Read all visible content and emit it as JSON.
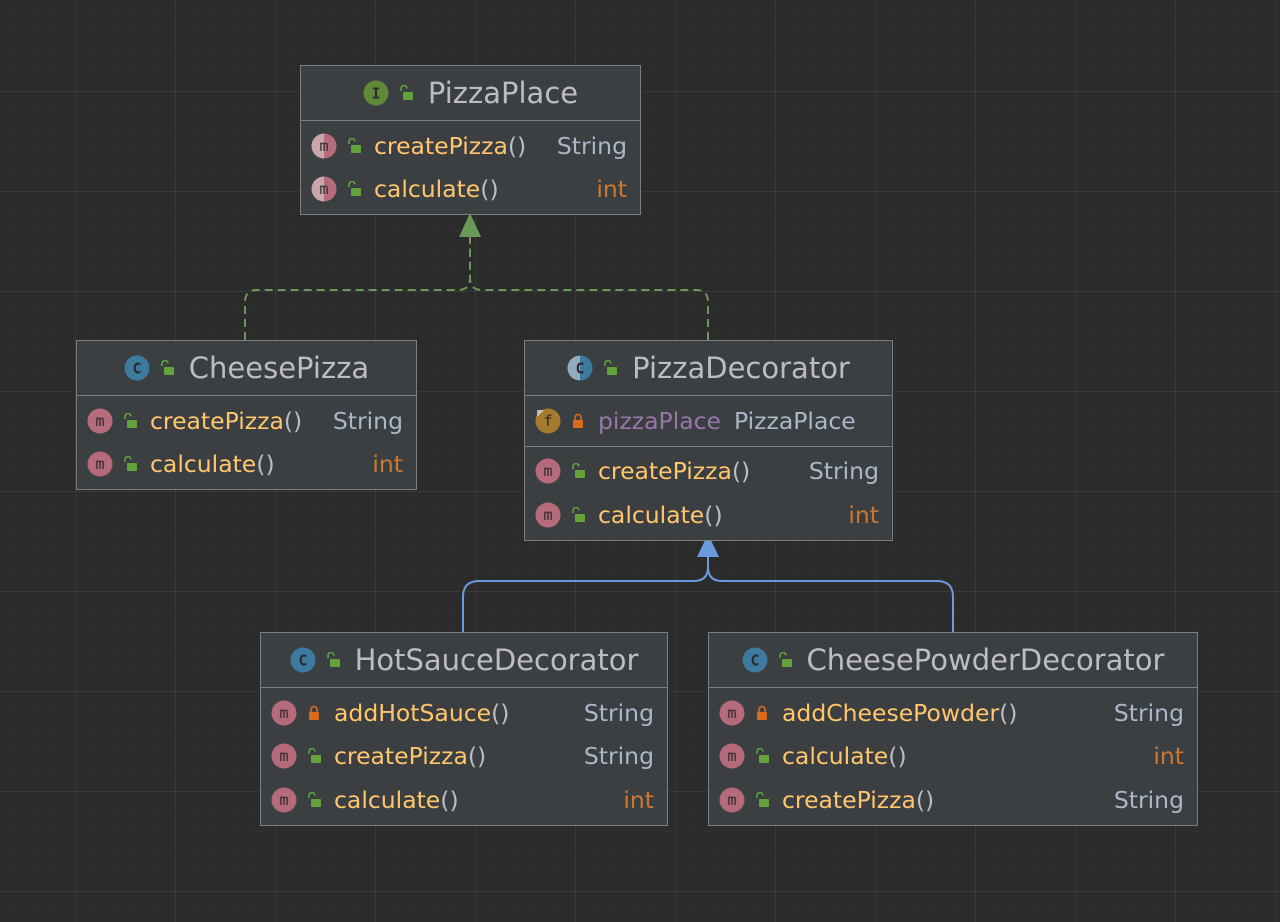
{
  "colors": {
    "realization_arrow": "#6a9955",
    "generalization_arrow": "#6b9bdc",
    "interface_icon": "#5f8a3a",
    "class_icon": "#3d7aa0",
    "method_icon": "#b56b79",
    "field_icon": "#a77b2f",
    "public_lock": "#62a33b",
    "private_lock": "#d96b1f"
  },
  "classes": {
    "pizza_place": {
      "kind": "interface",
      "name": "PizzaPlace",
      "methods": [
        {
          "name": "createPizza",
          "params": "()",
          "type": "String",
          "visibility": "public",
          "abstract": true
        },
        {
          "name": "calculate",
          "params": "()",
          "type": "int",
          "visibility": "public",
          "abstract": true
        }
      ]
    },
    "cheese_pizza": {
      "kind": "class",
      "name": "CheesePizza",
      "methods": [
        {
          "name": "createPizza",
          "params": "()",
          "type": "String",
          "visibility": "public"
        },
        {
          "name": "calculate",
          "params": "()",
          "type": "int",
          "visibility": "public"
        }
      ]
    },
    "pizza_decorator": {
      "kind": "abstract-class",
      "name": "PizzaDecorator",
      "fields": [
        {
          "name": "pizzaPlace",
          "type": "PizzaPlace",
          "visibility": "private"
        }
      ],
      "methods": [
        {
          "name": "createPizza",
          "params": "()",
          "type": "String",
          "visibility": "public"
        },
        {
          "name": "calculate",
          "params": "()",
          "type": "int",
          "visibility": "public"
        }
      ]
    },
    "hot_sauce_decorator": {
      "kind": "class",
      "name": "HotSauceDecorator",
      "methods": [
        {
          "name": "addHotSauce",
          "params": "()",
          "type": "String",
          "visibility": "private"
        },
        {
          "name": "createPizza",
          "params": "()",
          "type": "String",
          "visibility": "public"
        },
        {
          "name": "calculate",
          "params": "()",
          "type": "int",
          "visibility": "public"
        }
      ]
    },
    "cheese_powder_decorator": {
      "kind": "class",
      "name": "CheesePowderDecorator",
      "methods": [
        {
          "name": "addCheesePowder",
          "params": "()",
          "type": "String",
          "visibility": "private"
        },
        {
          "name": "calculate",
          "params": "()",
          "type": "int",
          "visibility": "public"
        },
        {
          "name": "createPizza",
          "params": "()",
          "type": "String",
          "visibility": "public"
        }
      ]
    }
  },
  "relations": [
    {
      "from": "CheesePizza",
      "to": "PizzaPlace",
      "type": "realization"
    },
    {
      "from": "PizzaDecorator",
      "to": "PizzaPlace",
      "type": "realization"
    },
    {
      "from": "HotSauceDecorator",
      "to": "PizzaDecorator",
      "type": "generalization"
    },
    {
      "from": "CheesePowderDecorator",
      "to": "PizzaDecorator",
      "type": "generalization"
    }
  ]
}
